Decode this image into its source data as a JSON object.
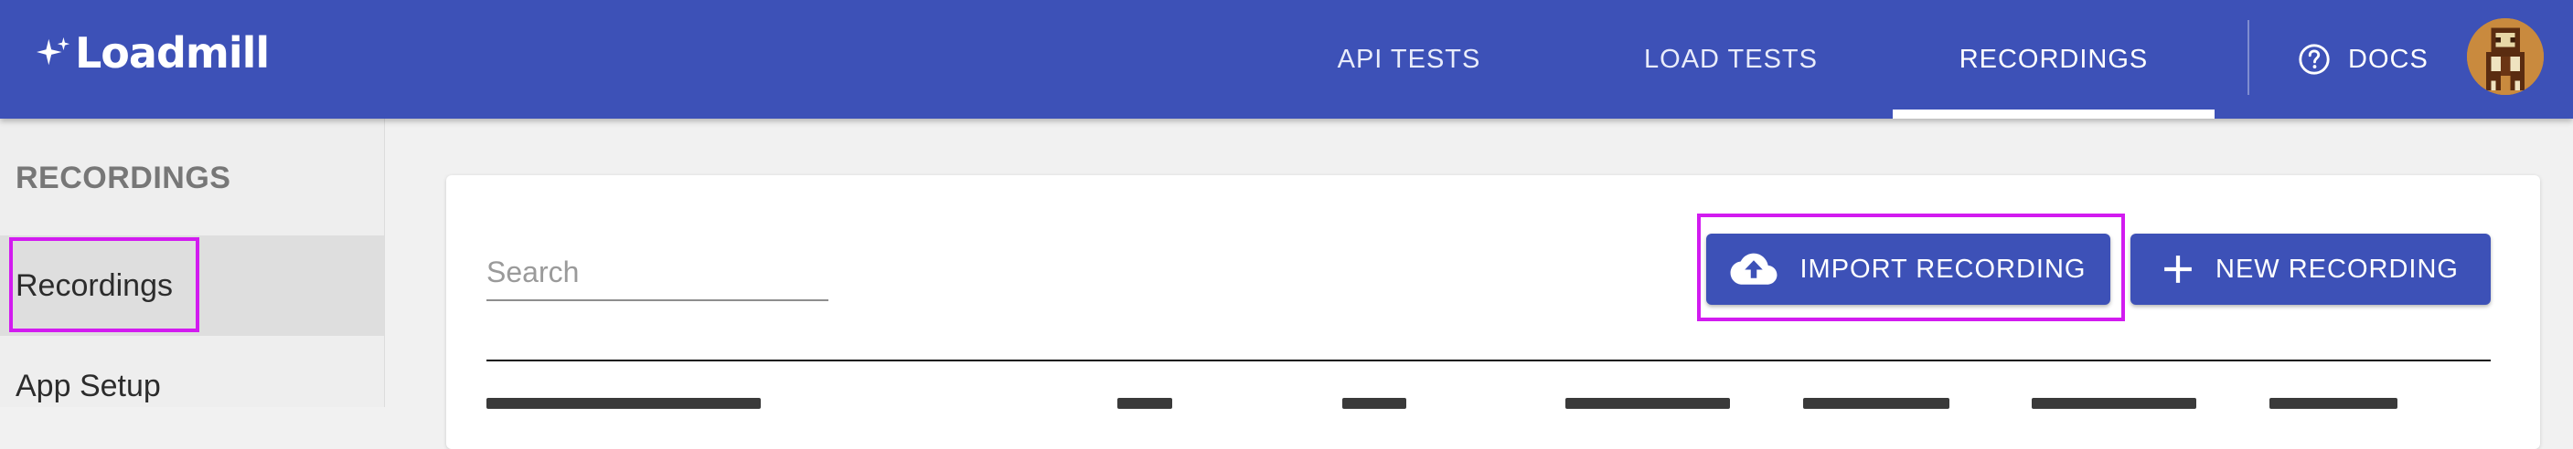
{
  "app": {
    "brand": "Loadmill"
  },
  "nav": {
    "tabs": [
      {
        "label": "API TESTS",
        "active": false
      },
      {
        "label": "LOAD TESTS",
        "active": false
      },
      {
        "label": "RECORDINGS",
        "active": true
      }
    ],
    "docs_label": "DOCS",
    "accent": "#3d51b7"
  },
  "sidebar": {
    "heading": "RECORDINGS",
    "items": [
      {
        "label": "Recordings",
        "active": true
      },
      {
        "label": "App Setup",
        "active": false
      }
    ]
  },
  "main": {
    "search": {
      "placeholder": "Search",
      "value": ""
    },
    "import_button": {
      "label": "IMPORT RECORDING",
      "icon": "cloud-upload-icon"
    },
    "new_button": {
      "label": "NEW RECORDING",
      "icon": "plus-icon"
    }
  },
  "highlight_color": "#d21bf0"
}
